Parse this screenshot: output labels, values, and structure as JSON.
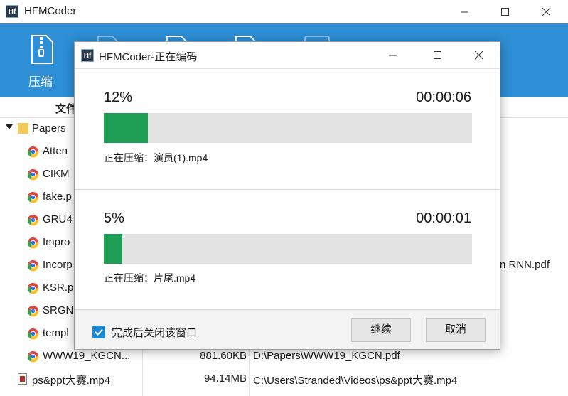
{
  "app": {
    "logo_text": "Hf",
    "title": "HFMCoder"
  },
  "toolbar": {
    "active_label": "压缩"
  },
  "file_table": {
    "name_header": "文件",
    "rows": [
      {
        "name": "Papers",
        "type": "folder",
        "expanded": true
      },
      {
        "name": "Atten",
        "type": "pdf"
      },
      {
        "name": "CIKM",
        "type": "pdf"
      },
      {
        "name": "fake.p",
        "type": "pdf"
      },
      {
        "name": "GRU4",
        "type": "pdf"
      },
      {
        "name": "Impro",
        "type": "pdf"
      },
      {
        "name": "Incorp",
        "type": "pdf",
        "path_tail": "n RNN.pdf"
      },
      {
        "name": "KSR.p",
        "type": "pdf"
      },
      {
        "name": "SRGN",
        "type": "pdf"
      },
      {
        "name": "templ",
        "type": "pdf"
      },
      {
        "name": "WWW19_KGCN...",
        "type": "pdf",
        "size": "881.60KB",
        "path": "D:\\Papers\\WWW19_KGCN.pdf"
      },
      {
        "name": "ps&ppt大赛.mp4",
        "type": "video",
        "size": "94.14MB",
        "path": "C:\\Users\\Stranded\\Videos\\ps&ppt大赛.mp4"
      }
    ]
  },
  "dialog": {
    "logo_text": "Hf",
    "title": "HFMCoder-正在编码",
    "tasks": [
      {
        "percent": "12%",
        "progress": 0.12,
        "time": "00:00:06",
        "status": "正在压缩：演员(1).mp4"
      },
      {
        "percent": "5%",
        "progress": 0.05,
        "time": "00:00:01",
        "status": "正在压缩：片尾.mp4"
      }
    ],
    "close_when_done": {
      "label": "完成后关闭该窗口",
      "checked": true
    },
    "continue_label": "继续",
    "cancel_label": "取消"
  },
  "colors": {
    "toolbar_bg": "#2e8fd6",
    "progress_fill": "#1e9e55",
    "progress_track": "#e3e3e3",
    "checkbox": "#1e88d3"
  }
}
